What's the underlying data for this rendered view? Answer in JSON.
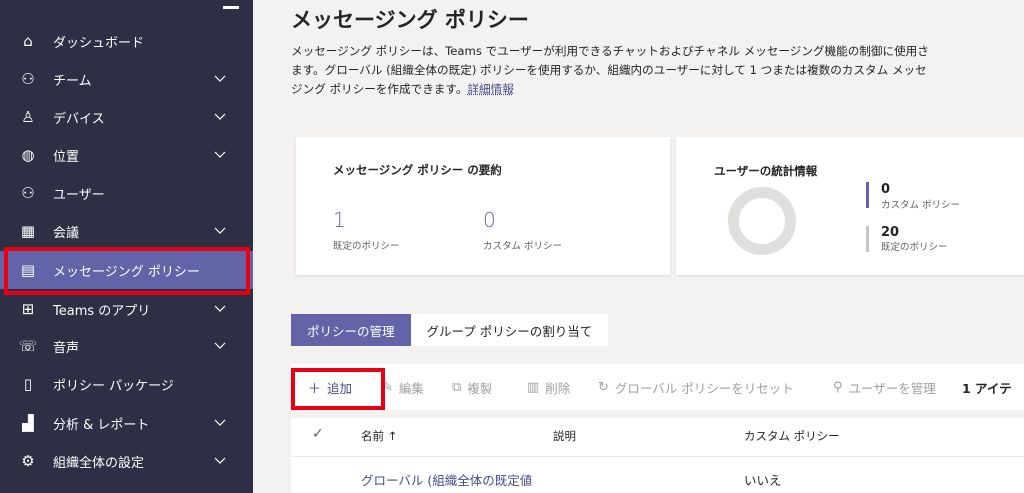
{
  "sidebar": {
    "items": [
      {
        "icon": "home-icon",
        "glyph": "⌂",
        "label": "ダッシュボード",
        "chevron": false
      },
      {
        "icon": "team-icon",
        "glyph": "⚇",
        "label": "チーム",
        "chevron": true
      },
      {
        "icon": "devices-icon",
        "glyph": "♙",
        "label": "デバイス",
        "chevron": true
      },
      {
        "icon": "globe-icon",
        "glyph": "◍",
        "label": "位置",
        "chevron": true
      },
      {
        "icon": "users-icon",
        "glyph": "⚇",
        "label": "ユーザー",
        "chevron": false
      },
      {
        "icon": "calendar-icon",
        "glyph": "▦",
        "label": "会議",
        "chevron": true
      },
      {
        "icon": "message-icon",
        "glyph": "▤",
        "label": "メッセージング ポリシー",
        "chevron": false,
        "active": true
      },
      {
        "icon": "apps-icon",
        "glyph": "⊞",
        "label": "Teams のアプリ",
        "chevron": true
      },
      {
        "icon": "voice-icon",
        "glyph": "☏",
        "label": "音声",
        "chevron": true
      },
      {
        "icon": "package-icon",
        "glyph": "▯",
        "label": "ポリシー パッケージ",
        "chevron": false
      },
      {
        "icon": "analytics-icon",
        "glyph": "▟",
        "label": "分析 & レポート",
        "chevron": true
      },
      {
        "icon": "gear-icon",
        "glyph": "⚙",
        "label": "組織全体の設定",
        "chevron": true
      }
    ]
  },
  "page": {
    "title": "メッセージング ポリシー",
    "desc_line1": "メッセージング ポリシーは、Teams でユーザーが利用できるチャットおよびチャネル メッセージング機能の制御に使用さ",
    "desc_line2": "ます。グローバル (組織全体の既定) ポリシーを使用するか、組織内のユーザーに対して 1 つまたは複数のカスタム メッセ",
    "desc_line3": "ジング ポリシーを作成できます。",
    "learn_more": "詳細情報"
  },
  "summary_card": {
    "title": "メッセージング ポリシー の要約",
    "default_count": "1",
    "default_label": "既定のポリシー",
    "custom_count": "0",
    "custom_label": "カスタム ポリシー"
  },
  "stats_card": {
    "title": "ユーザーの統計情報",
    "legend": [
      {
        "value": "0",
        "label": "カスタム ポリシー",
        "color": "#6264a7"
      },
      {
        "value": "20",
        "label": "既定のポリシー",
        "color": "#c8c6c4"
      }
    ]
  },
  "tabs": [
    {
      "label": "ポリシーの管理",
      "active": true
    },
    {
      "label": "グループ ポリシーの割り当て",
      "active": false
    }
  ],
  "toolbar": {
    "add": "追加",
    "edit": "編集",
    "duplicate": "複製",
    "delete": "削除",
    "reset": "グローバル ポリシーをリセット",
    "manage_users": "ユーザーを管理",
    "count": "1 アイテ"
  },
  "table": {
    "columns": [
      "名前 ↑",
      "説明",
      "カスタム ポリシー"
    ],
    "rows": [
      {
        "name": "グローバル (組織全体の既定値",
        "description": "",
        "custom": "いいえ"
      }
    ]
  },
  "colors": {
    "accent": "#6264a7",
    "sidebar": "#2e2f45",
    "highlight": "#e60012"
  }
}
